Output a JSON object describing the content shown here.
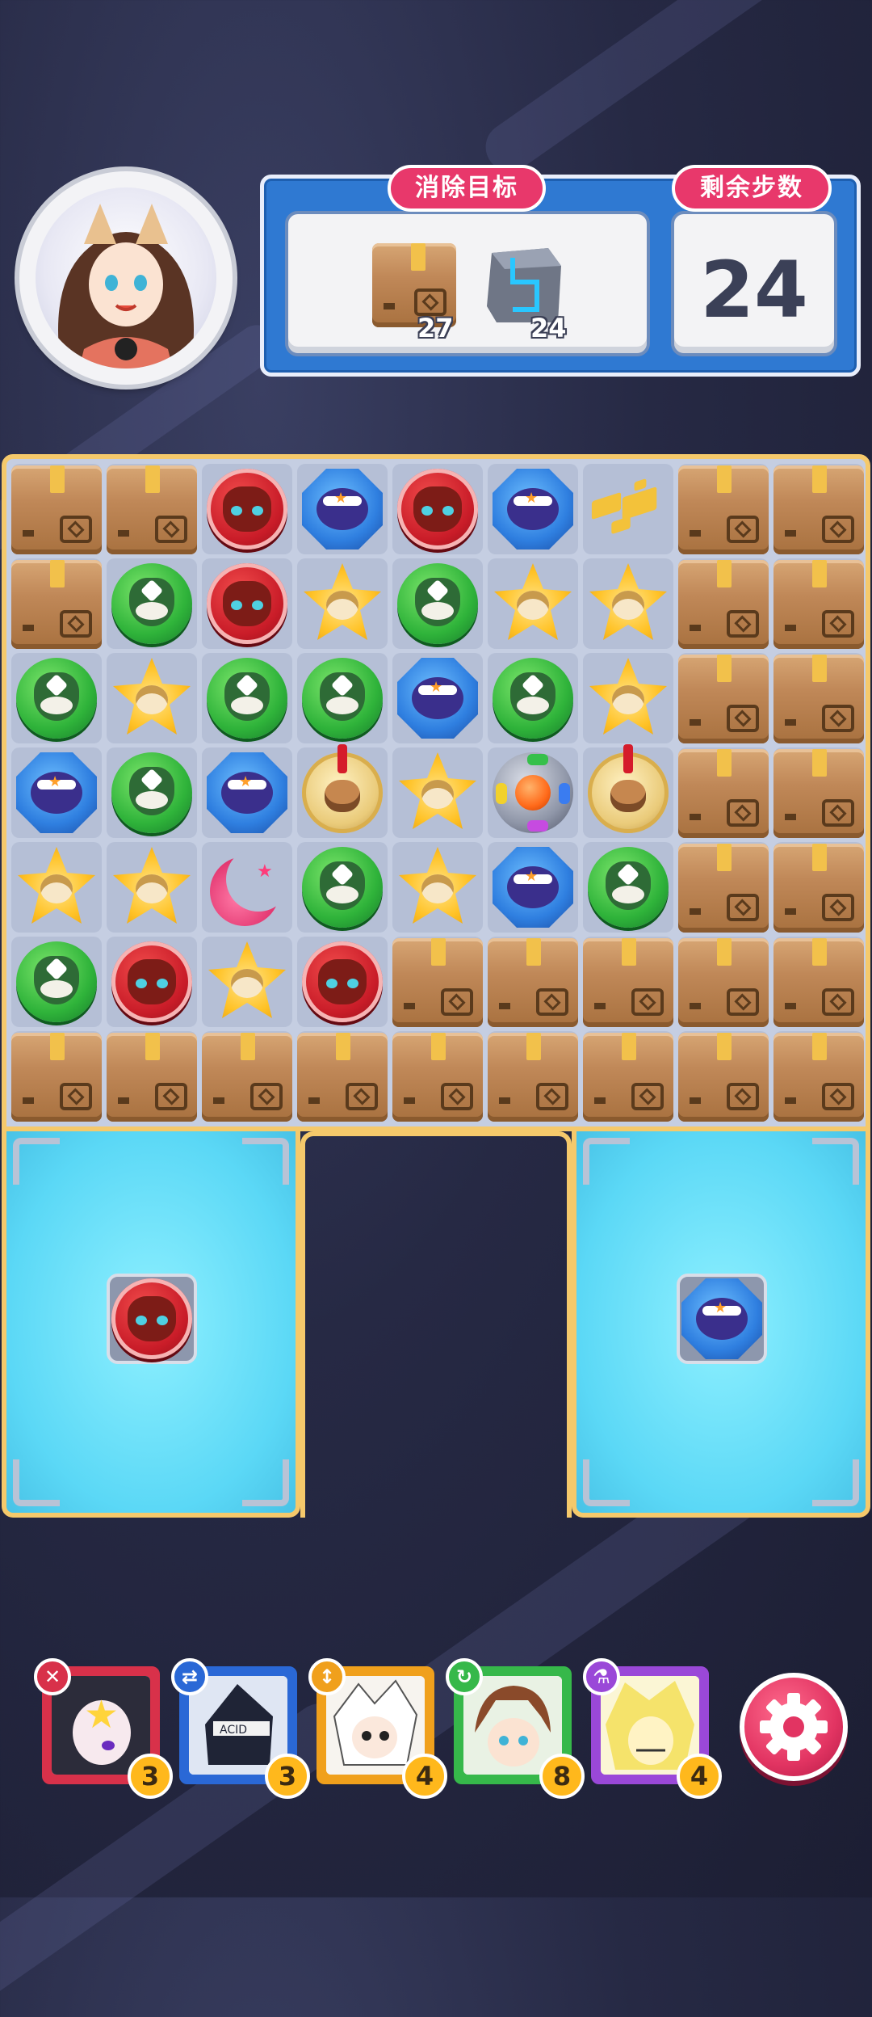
{
  "goal_panel": {
    "title": "消除目标",
    "targets": [
      {
        "icon": "cardboard-box-icon",
        "count": "27"
      },
      {
        "icon": "metal-block-icon",
        "count": "24"
      }
    ]
  },
  "moves": {
    "title": "剩余步数",
    "value": "24"
  },
  "board": {
    "rows": [
      [
        "box",
        "box",
        "red",
        "blue",
        "red",
        "blue",
        "shards",
        "box",
        "box"
      ],
      [
        "box",
        "green",
        "red",
        "yellow",
        "green",
        "yellow",
        "yellow",
        "box",
        "box"
      ],
      [
        "green",
        "yellow",
        "green",
        "green",
        "blue",
        "green",
        "yellow",
        "box",
        "box"
      ],
      [
        "blue",
        "green",
        "blue",
        "medal",
        "yellow",
        "bomb",
        "medal",
        "box",
        "box"
      ],
      [
        "yellow",
        "yellow",
        "moon",
        "green",
        "yellow",
        "blue",
        "green",
        "box",
        "box"
      ],
      [
        "green",
        "red",
        "yellow",
        "red",
        "box",
        "box",
        "box",
        "box",
        "box"
      ],
      [
        "box",
        "box",
        "box",
        "box",
        "box",
        "box",
        "box",
        "box",
        "box"
      ]
    ]
  },
  "collectors": [
    {
      "piece": "red"
    },
    {
      "piece": "blue"
    }
  ],
  "heroes": [
    {
      "name": "hero-star-hood",
      "skill_icon": "cross-icon",
      "skill_symbol": "✕",
      "count": "3",
      "color": "#d8314a"
    },
    {
      "name": "hero-masked-blue",
      "skill_icon": "swap-arrows-icon",
      "skill_symbol": "⇄",
      "count": "3",
      "color": "#2a68d6"
    },
    {
      "name": "hero-white-hair",
      "skill_icon": "vertical-arrows-icon",
      "skill_symbol": "↕",
      "count": "4",
      "color": "#f0a01c"
    },
    {
      "name": "hero-brown-hair",
      "skill_icon": "refresh-icon",
      "skill_symbol": "↻",
      "count": "8",
      "color": "#36b84a"
    },
    {
      "name": "hero-blonde",
      "skill_icon": "potion-icon",
      "skill_symbol": "⚗",
      "count": "4",
      "color": "#9a48d8"
    }
  ],
  "colors": {
    "accent": "#e8386b",
    "panel_blue": "#2f79d2",
    "board_border": "#f5c96b",
    "collector": "#5bd8f6"
  }
}
